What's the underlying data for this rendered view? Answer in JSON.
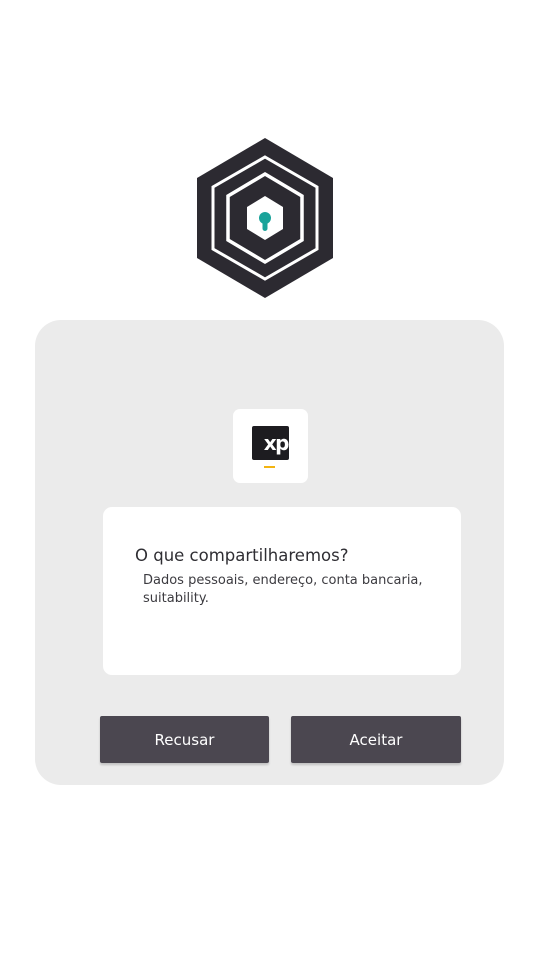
{
  "hero": {
    "icon": "shield-keyhole-hexagon-icon"
  },
  "card": {
    "logo": {
      "text": "xp",
      "icon": "xp-logo-icon"
    },
    "info": {
      "title": "O que compartilharemos?",
      "description": "Dados pessoais, endereço, conta bancaria, suitability."
    },
    "buttons": {
      "refuse_label": "Recusar",
      "accept_label": "Aceitar"
    }
  },
  "colors": {
    "page_background": "#ffffff",
    "card_background": "#ebebeb",
    "button_background": "#4b4750",
    "hexagon_dark": "#2c2a31",
    "keyhole_accent": "#1aa39a",
    "logo_underline": "#f3b411"
  }
}
